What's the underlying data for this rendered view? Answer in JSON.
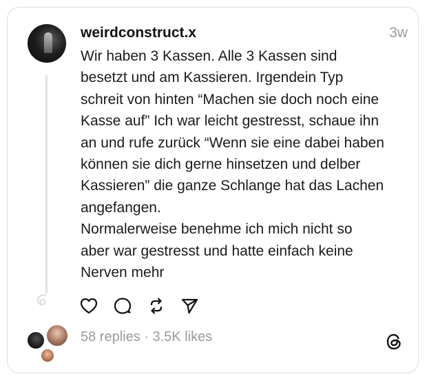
{
  "post": {
    "username": "weirdconstruct.x",
    "time": "3w",
    "lines": [
      "Wir haben 3 Kassen. Alle 3 Kassen sind",
      "besetzt und am Kassieren. Irgendein Typ",
      "schreit von hinten “Machen sie doch noch eine",
      "Kasse auf” Ich war leicht gestresst, schaue ihn",
      "an und rufe zurück “Wenn sie eine dabei haben",
      "können sie dich gerne hinsetzen und delber",
      "Kassieren” die ganze Schlange hat das Lachen",
      "angefangen.",
      "Normalerweise benehme ich mich nicht so",
      "aber war gestresst und hatte einfach keine",
      "Nerven mehr"
    ]
  },
  "actions": [
    {
      "name": "like",
      "icon": "heart-icon"
    },
    {
      "name": "reply",
      "icon": "comment-icon"
    },
    {
      "name": "repost",
      "icon": "repost-icon"
    },
    {
      "name": "share",
      "icon": "send-icon"
    }
  ],
  "footer": {
    "stats": "58 replies · 3.5K likes",
    "logo_icon": "threads-logo-icon"
  }
}
